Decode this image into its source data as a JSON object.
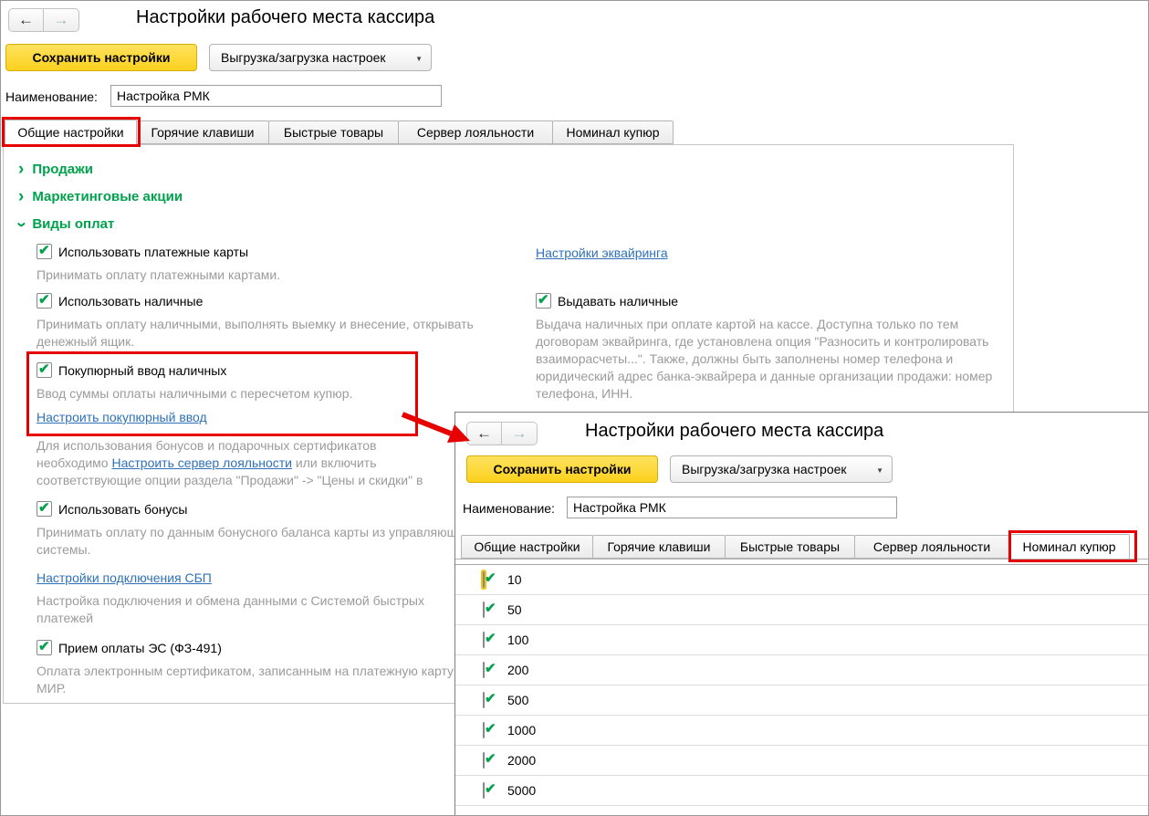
{
  "icons": {
    "back_arrow": "←",
    "forward_arrow": "→",
    "dropdown_caret": "▼",
    "section_chevron": "›"
  },
  "main_window": {
    "title": "Настройки рабочего места кассира",
    "toolbar": {
      "save_label": "Сохранить настройки",
      "export_label": "Выгрузка/загрузка настроек"
    },
    "name_field": {
      "label": "Наименование:",
      "value": "Настройка РМК"
    },
    "tabs": [
      {
        "label": "Общие настройки"
      },
      {
        "label": "Горячие клавиши"
      },
      {
        "label": "Быстрые товары"
      },
      {
        "label": "Сервер лояльности"
      },
      {
        "label": "Номинал купюр"
      }
    ],
    "sections": [
      {
        "label": "Продажи"
      },
      {
        "label": "Маркетинговые акции"
      },
      {
        "label": "Виды оплат"
      }
    ],
    "payments": {
      "card": {
        "label": "Использовать платежные карты",
        "desc": "Принимать оплату платежными картами."
      },
      "acquiring_link": "Настройки эквайринга",
      "cash": {
        "label": "Использовать наличные",
        "desc": "Принимать оплату наличными, выполнять выемку и внесение, открывать денежный ящик."
      },
      "cash_out": {
        "label": "Выдавать наличные",
        "desc": "Выдача наличных при оплате картой на кассе. Доступна только по тем договорам эквайринга, где установлена опция \"Разносить и контролировать взаиморасчеты...\". Также, должны быть заполнены номер телефона и юридический адрес банка-эквайрера и данные организации продажи: номер телефона, ИНН."
      },
      "banknote": {
        "label": "Покупюрный ввод наличных",
        "desc": "Ввод суммы оплаты наличными с пересчетом купюр.",
        "link": "Настроить покупюрный ввод"
      },
      "bonus_note": {
        "text_before": "Для использования бонусов и подарочных сертификатов необходимо",
        "link": "Настроить сервер лояльности",
        "text_after": "или включить соответствующие опции раздела \"Продажи\" -> \"Цены и скидки\" в"
      },
      "bonuses": {
        "label": "Использовать бонусы",
        "desc": "Принимать оплату по данным бонусного баланса карты из управляющей системы."
      },
      "sbp": {
        "link": "Настройки подключения СБП",
        "desc": "Настройка подключения и обмена данными с Системой быстрых платежей"
      },
      "es": {
        "label": "Прием оплаты ЭС (ФЗ-491)",
        "desc": "Оплата электронным сертификатом, записанным на платежную карту МИР."
      }
    }
  },
  "overlay_window": {
    "title": "Настройки рабочего места кассира",
    "toolbar": {
      "save_label": "Сохранить настройки",
      "export_label": "Выгрузка/загрузка настроек"
    },
    "name_field": {
      "label": "Наименование:",
      "value": "Настройка РМК"
    },
    "tabs": [
      {
        "label": "Общие настройки"
      },
      {
        "label": "Горячие клавиши"
      },
      {
        "label": "Быстрые товары"
      },
      {
        "label": "Сервер лояльности"
      },
      {
        "label": "Номинал купюр"
      }
    ],
    "denominations": [
      {
        "value": "10"
      },
      {
        "value": "50"
      },
      {
        "value": "100"
      },
      {
        "value": "200"
      },
      {
        "value": "500"
      },
      {
        "value": "1000"
      },
      {
        "value": "2000"
      },
      {
        "value": "5000"
      }
    ]
  }
}
